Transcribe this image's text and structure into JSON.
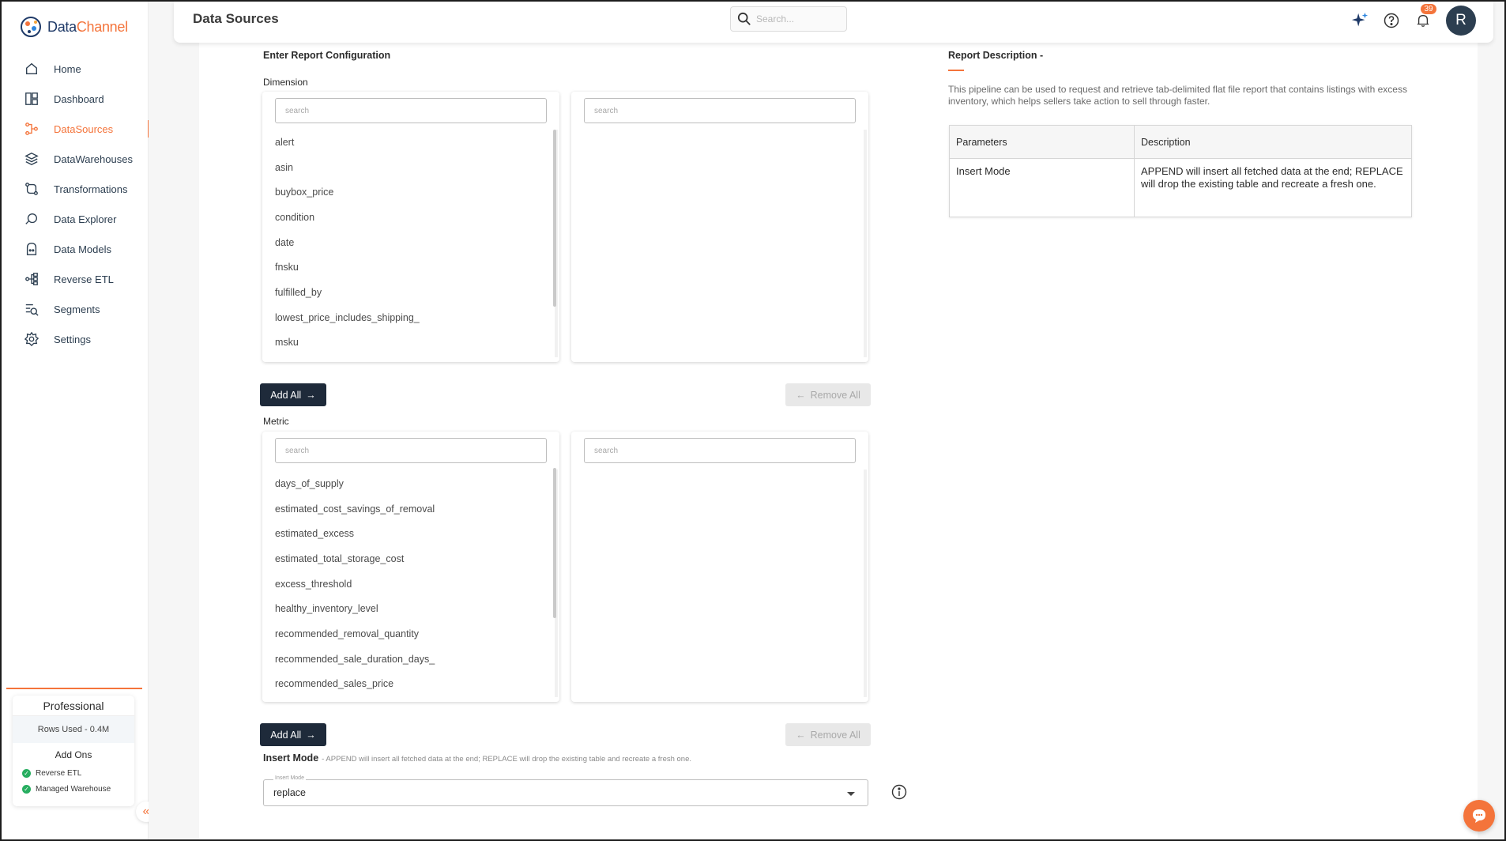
{
  "brand": {
    "name_part1": "Data",
    "name_part2": "Channel"
  },
  "sidebar": {
    "items": [
      {
        "label": "Home",
        "icon": "home-icon",
        "active": false
      },
      {
        "label": "Dashboard",
        "icon": "dashboard-icon",
        "active": false
      },
      {
        "label": "DataSources",
        "icon": "datasources-icon",
        "active": true
      },
      {
        "label": "DataWarehouses",
        "icon": "layers-icon",
        "active": false
      },
      {
        "label": "Transformations",
        "icon": "transform-icon",
        "active": false
      },
      {
        "label": "Data Explorer",
        "icon": "explorer-icon",
        "active": false
      },
      {
        "label": "Data Models",
        "icon": "models-icon",
        "active": false
      },
      {
        "label": "Reverse ETL",
        "icon": "reverse-etl-icon",
        "active": false
      },
      {
        "label": "Segments",
        "icon": "segments-icon",
        "active": false
      },
      {
        "label": "Settings",
        "icon": "gear-icon",
        "active": false
      }
    ],
    "plan": {
      "title": "Professional",
      "rows_used": "Rows Used - 0.4M",
      "addons_title": "Add Ons",
      "addons": [
        "Reverse ETL",
        "Managed Warehouse"
      ]
    }
  },
  "header": {
    "title": "Data Sources",
    "search_placeholder": "Search...",
    "notification_count": "39",
    "avatar_letter": "R"
  },
  "config": {
    "heading": "Enter Report Configuration",
    "dimension": {
      "label": "Dimension",
      "left_search_placeholder": "search",
      "right_search_placeholder": "search",
      "items": [
        "alert",
        "asin",
        "buybox_price",
        "condition",
        "date",
        "fnsku",
        "fulfilled_by",
        "lowest_price_includes_shipping_",
        "msku"
      ]
    },
    "metric": {
      "label": "Metric",
      "left_search_placeholder": "search",
      "right_search_placeholder": "search",
      "items": [
        "days_of_supply",
        "estimated_cost_savings_of_removal",
        "estimated_excess",
        "estimated_total_storage_cost",
        "excess_threshold",
        "healthy_inventory_level",
        "recommended_removal_quantity",
        "recommended_sale_duration_days_",
        "recommended_sales_price"
      ]
    },
    "add_all_label": "Add All",
    "remove_all_label": "Remove All",
    "insert_mode": {
      "label": "Insert Mode",
      "hint": "- APPEND will insert all fetched data at the end; REPLACE will drop the existing table and recreate a fresh one.",
      "field_legend": "Insert Mode",
      "value": "replace"
    }
  },
  "report_description": {
    "title": "Report Description -",
    "text": "This pipeline can be used to request and retrieve tab-delimited flat file report that contains listings with excess inventory, which helps sellers take action to sell through faster.",
    "table": {
      "headers": [
        "Parameters",
        "Description"
      ],
      "rows": [
        [
          "Insert Mode",
          "APPEND will insert all fetched data at the end; REPLACE will drop the existing table and recreate a fresh one."
        ]
      ]
    }
  },
  "colors": {
    "accent": "#f4743b",
    "primary_dark": "#1e2a3a",
    "navy": "#2c3e50"
  }
}
